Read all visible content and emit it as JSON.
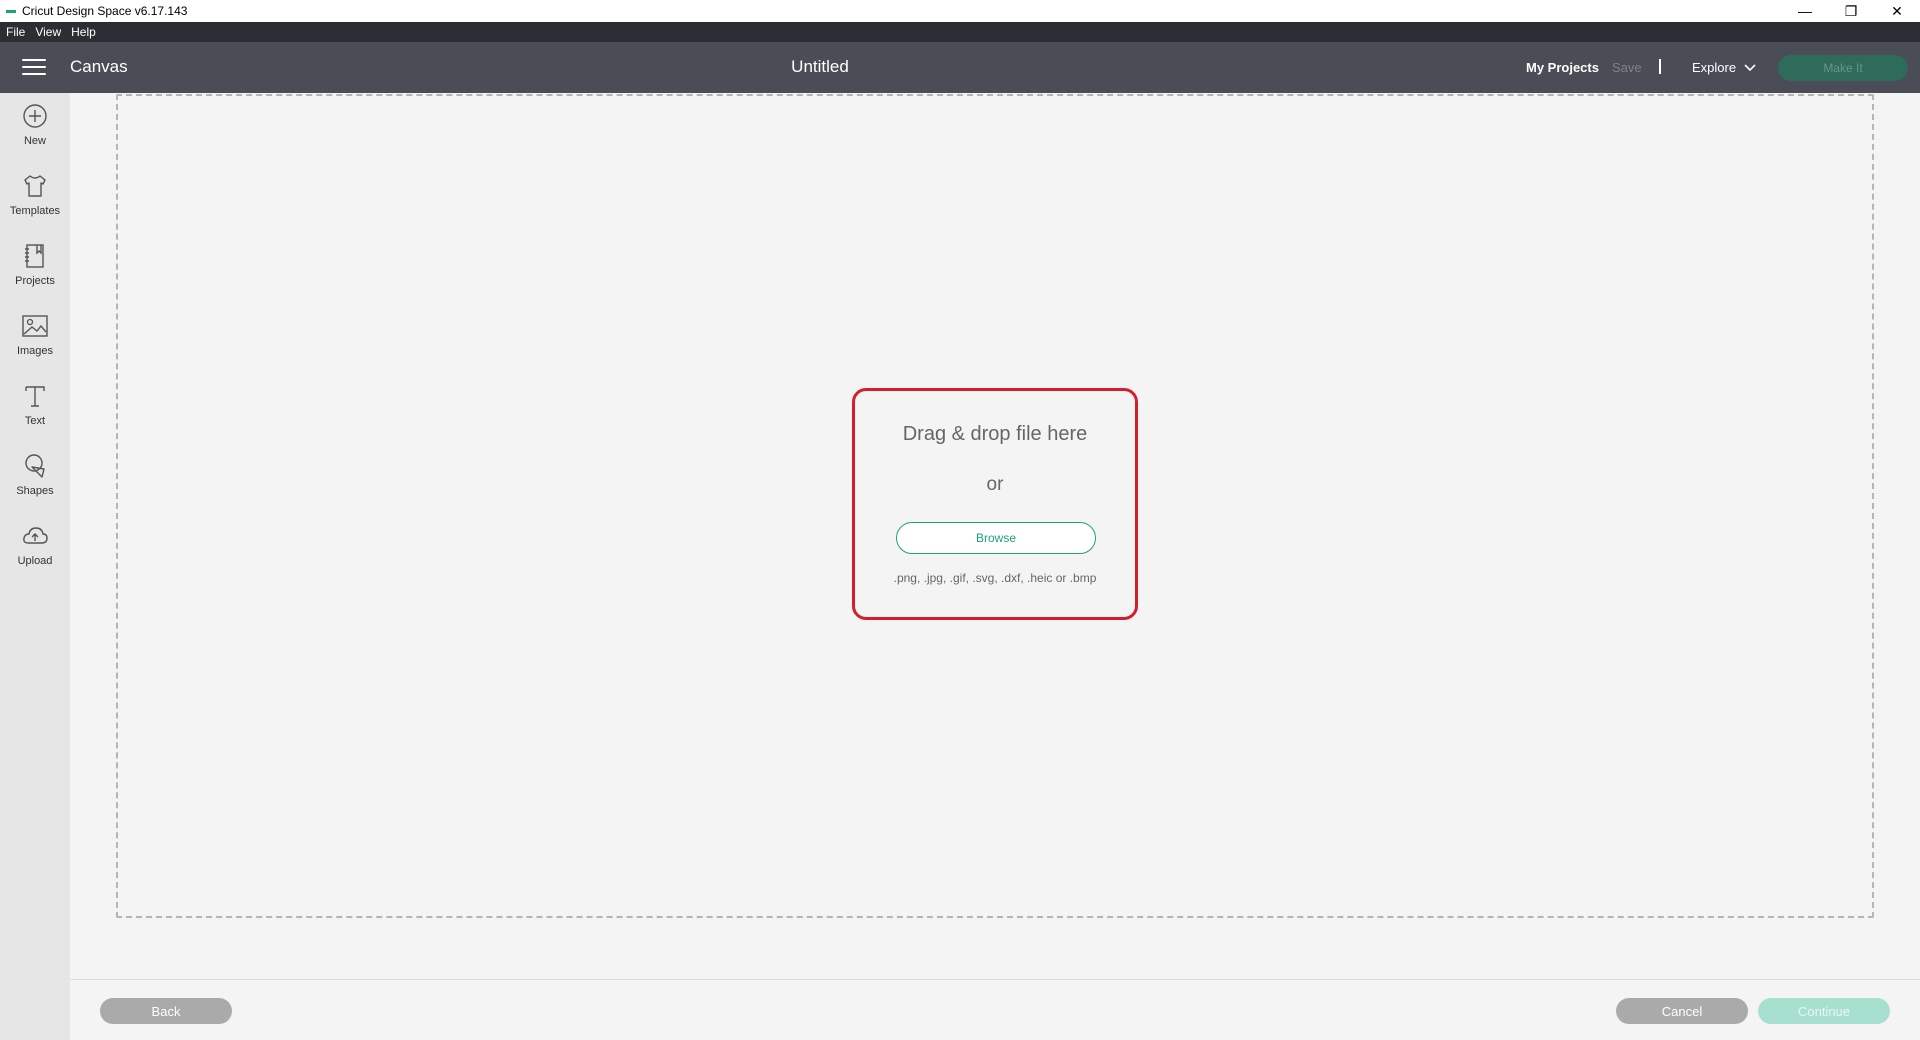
{
  "window": {
    "title": "Cricut Design Space  v6.17.143",
    "controls": {
      "minimize": "—",
      "restore": "❐",
      "close": "✕"
    }
  },
  "menu": [
    "File",
    "View",
    "Help"
  ],
  "header": {
    "section": "Canvas",
    "document_title": "Untitled",
    "my_projects": "My Projects",
    "save": "Save",
    "explore": "Explore",
    "make_it": "Make It"
  },
  "sidebar": {
    "items": [
      {
        "label": "New",
        "icon": "plus-circle-icon"
      },
      {
        "label": "Templates",
        "icon": "tshirt-icon"
      },
      {
        "label": "Projects",
        "icon": "notebook-icon"
      },
      {
        "label": "Images",
        "icon": "image-icon"
      },
      {
        "label": "Text",
        "icon": "text-icon"
      },
      {
        "label": "Shapes",
        "icon": "shapes-icon"
      },
      {
        "label": "Upload",
        "icon": "cloud-upload-icon"
      }
    ]
  },
  "upload": {
    "drag_text": "Drag & drop file here",
    "or_text": "or",
    "browse": "Browse",
    "formats": ".png, .jpg, .gif, .svg, .dxf, .heic or .bmp"
  },
  "footer": {
    "back": "Back",
    "cancel": "Cancel",
    "continue": "Continue"
  },
  "colors": {
    "accent": "#1fa17b",
    "header_bg": "#4a4d55",
    "highlight": "#d1202c"
  }
}
